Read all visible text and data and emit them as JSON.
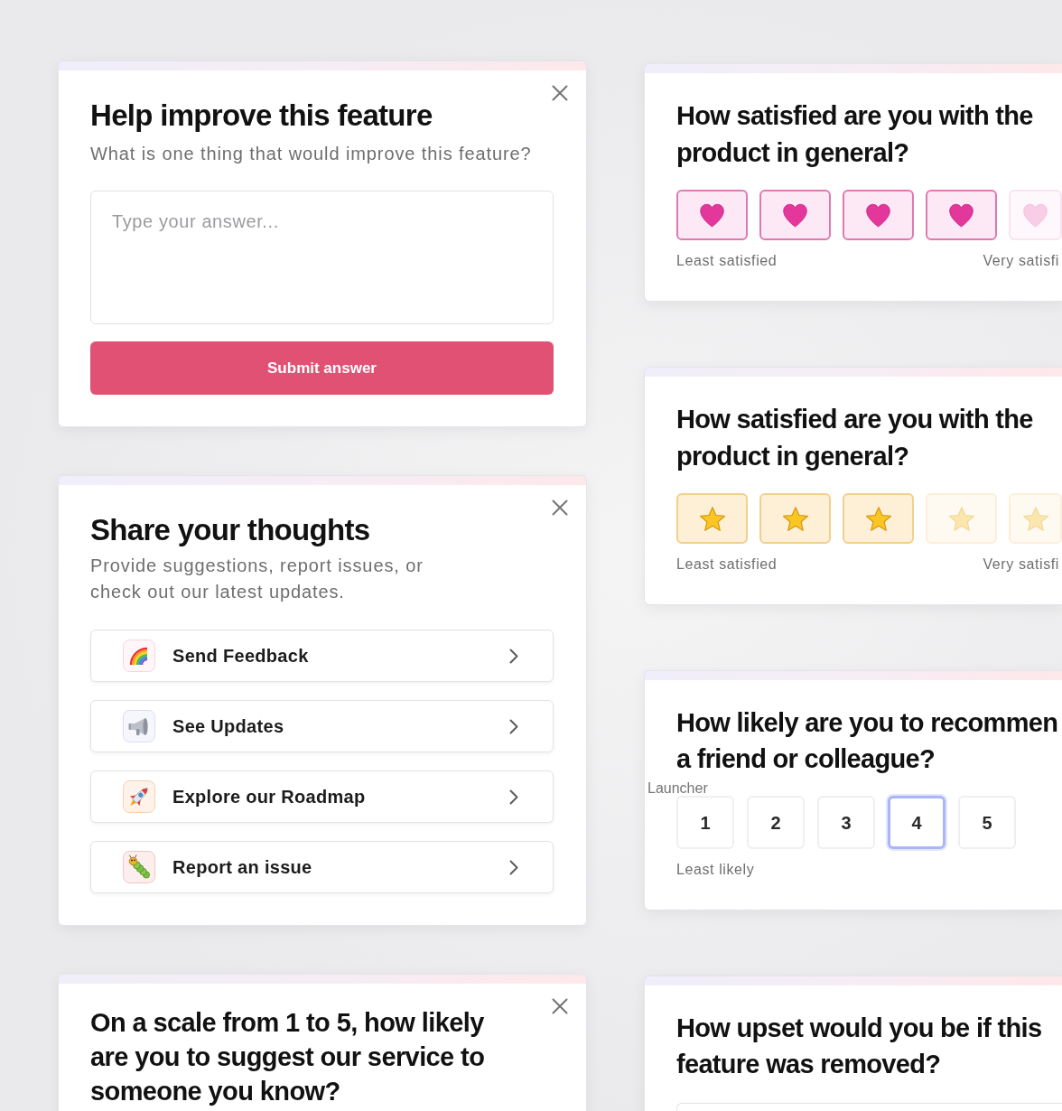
{
  "left_column": [
    {
      "kind": "open_text",
      "closable": true,
      "title": "Help improve this feature",
      "subtitle": "What is one thing that would improve this feature?",
      "answer": {
        "placeholder": "Type your answer..."
      },
      "submit": "Submit answer"
    },
    {
      "kind": "menu",
      "closable": true,
      "title": "Share your thoughts",
      "subtitle": "Provide suggestions, report issues, or check out our latest updates.",
      "items": [
        {
          "kind": "feedback",
          "label": "Send Feedback"
        },
        {
          "kind": "updates",
          "label": "See Updates"
        },
        {
          "kind": "roadmap",
          "label": "Explore our Roadmap"
        },
        {
          "kind": "issue",
          "label": "Report an issue"
        }
      ]
    },
    {
      "kind": "question",
      "closable": true,
      "title": "On a scale from 1 to 5, how likely are you to suggest our service to someone you know?"
    }
  ],
  "right_column": [
    {
      "kind": "heart_rating",
      "title": "How satisfied are you with the product in general?",
      "options": [
        {
          "selected": true
        },
        {
          "selected": true
        },
        {
          "selected": true
        },
        {
          "selected": true
        },
        {
          "selected": false
        }
      ],
      "low_label": "Least satisfied",
      "high_label": "Very satisfi"
    },
    {
      "kind": "star_rating",
      "title": "How satisfied are you with the product in general?",
      "options": [
        {
          "selected": true
        },
        {
          "selected": true
        },
        {
          "selected": true
        },
        {
          "selected": false
        },
        {
          "selected": false
        }
      ],
      "low_label": "Least satisfied",
      "high_label": "Very satisfi"
    },
    {
      "kind": "number_scale",
      "title_lines": [
        "How likely are you to recommen",
        "a friend or colleague?"
      ],
      "overlay_label": "Launcher",
      "options": [
        {
          "label": "1",
          "selected": false
        },
        {
          "label": "2",
          "selected": false
        },
        {
          "label": "3",
          "selected": false
        },
        {
          "label": "4",
          "selected": true
        },
        {
          "label": "5",
          "selected": false
        }
      ],
      "low_label": "Least likely"
    },
    {
      "kind": "open_text",
      "title": "How upset would you be if this feature was removed?"
    }
  ]
}
